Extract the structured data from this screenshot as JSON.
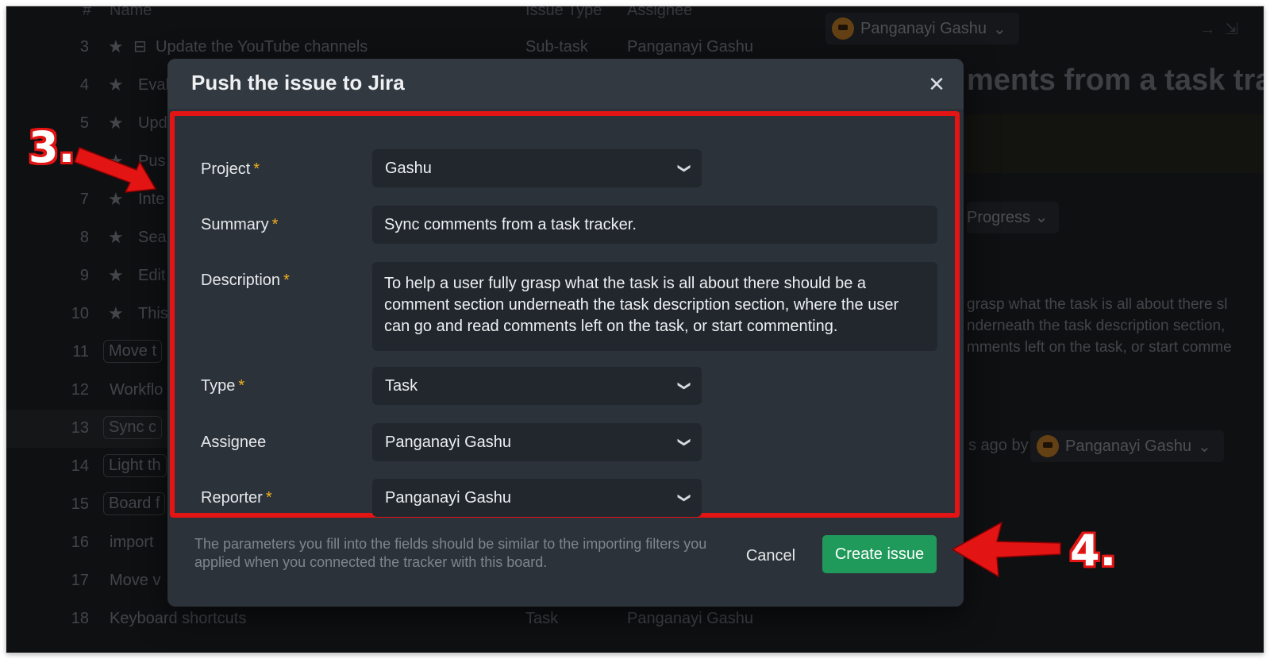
{
  "background": {
    "list_header": {
      "num": "#",
      "name": "Name",
      "issue_type": "Issue Type",
      "assignee": "Assignee"
    },
    "rows": [
      {
        "num": "3",
        "title": "Update the YouTube channels",
        "issue_type": "Sub-task",
        "assignee": "Panganayi Gashu"
      },
      {
        "num": "4",
        "title": "Eval"
      },
      {
        "num": "5",
        "title": "Upd"
      },
      {
        "num": "6",
        "title": "Pus"
      },
      {
        "num": "7",
        "title": "Inte"
      },
      {
        "num": "8",
        "title": "Sea"
      },
      {
        "num": "9",
        "title": "Edit"
      },
      {
        "num": "10",
        "title": "This"
      },
      {
        "num": "11",
        "title": "Move t"
      },
      {
        "num": "12",
        "title": "Workflo"
      },
      {
        "num": "13",
        "title": "Sync c"
      },
      {
        "num": "14",
        "title": "Light th"
      },
      {
        "num": "15",
        "title": "Board f"
      },
      {
        "num": "16",
        "title": "import"
      },
      {
        "num": "17",
        "title": "Move v"
      },
      {
        "num": "18",
        "title": "Keyboard shortcuts",
        "issue_type": "Task",
        "assignee": "Panganayi Gashu"
      }
    ],
    "right_pane": {
      "user": "Panganayi Gashu",
      "heading": "ments from a task tra",
      "status": "Progress",
      "description_lines": [
        "grasp what the task is all about there sl",
        "nderneath the task description section,",
        "mments left on the task, or start comme"
      ],
      "activity_text": "s ago by",
      "activity_user": "Panganayi Gashu"
    }
  },
  "modal": {
    "title": "Push the issue to Jira",
    "close_symbol": "✕",
    "required_mark": "*",
    "fields": {
      "project": {
        "label": "Project",
        "value": "Gashu"
      },
      "summary": {
        "label": "Summary",
        "value": "Sync comments from a task tracker."
      },
      "description": {
        "label": "Description",
        "value": "To help a user fully grasp what the task is all about there should be a comment section underneath the task description section, where the user can go and read comments left on the task, or start commenting."
      },
      "type": {
        "label": "Type",
        "value": "Task"
      },
      "assignee": {
        "label": "Assignee",
        "value": "Panganayi Gashu"
      },
      "reporter": {
        "label": "Reporter",
        "value": "Panganayi Gashu"
      }
    },
    "footer_note": "The parameters you fill into the fields should be similar to the importing filters you applied when you connected the tracker with this board.",
    "cancel_label": "Cancel",
    "create_label": "Create issue"
  },
  "annotations": {
    "step3": "3.",
    "step4": "4.",
    "color": "#e31414"
  },
  "colors": {
    "accent_green": "#1f9a5a",
    "required_star": "#f2b01e",
    "modal_bg": "#2c323a"
  }
}
